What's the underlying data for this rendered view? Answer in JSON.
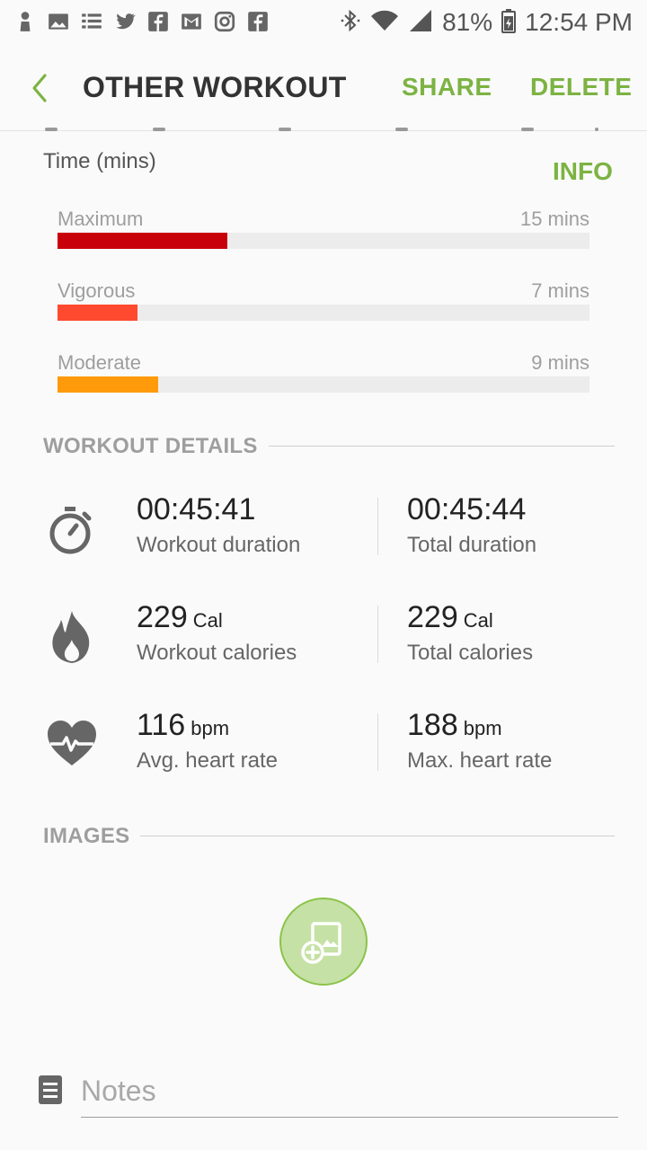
{
  "status_bar": {
    "battery": "81%",
    "time": "12:54 PM",
    "left_icons": [
      "person-icon",
      "image-icon",
      "list-icon",
      "twitter-icon",
      "facebook-icon",
      "gmail-icon",
      "instagram-icon",
      "facebook-icon"
    ],
    "right_icons": [
      "bluetooth-icon",
      "wifi-icon",
      "signal-icon",
      "battery-icon"
    ]
  },
  "appbar": {
    "title": "OTHER WORKOUT",
    "share_label": "SHARE",
    "delete_label": "DELETE",
    "accent_color": "#7cb342"
  },
  "heart_rate_zones": {
    "axis_label": "Time (mins)",
    "info_label": "INFO",
    "zones": [
      {
        "name": "Maximum",
        "value": "15 mins",
        "fraction": 0.32,
        "color": "#c8000a"
      },
      {
        "name": "Vigorous",
        "value": "7 mins",
        "fraction": 0.15,
        "color": "#ff4a2f"
      },
      {
        "name": "Moderate",
        "value": "9 mins",
        "fraction": 0.19,
        "color": "#ff9a0a"
      }
    ]
  },
  "workout_details": {
    "section_title": "WORKOUT DETAILS",
    "rows": [
      {
        "icon": "stopwatch-icon",
        "left": {
          "value": "00:45:41",
          "unit": "",
          "label": "Workout duration"
        },
        "right": {
          "value": "00:45:44",
          "unit": "",
          "label": "Total duration"
        }
      },
      {
        "icon": "flame-icon",
        "left": {
          "value": "229",
          "unit": "Cal",
          "label": "Workout calories"
        },
        "right": {
          "value": "229",
          "unit": "Cal",
          "label": "Total calories"
        }
      },
      {
        "icon": "heart-rate-icon",
        "left": {
          "value": "116",
          "unit": "bpm",
          "label": "Avg. heart rate"
        },
        "right": {
          "value": "188",
          "unit": "bpm",
          "label": "Max. heart rate"
        }
      }
    ]
  },
  "images": {
    "section_title": "IMAGES",
    "add_button_icon": "add-image-icon"
  },
  "notes": {
    "placeholder": "Notes",
    "value": ""
  }
}
